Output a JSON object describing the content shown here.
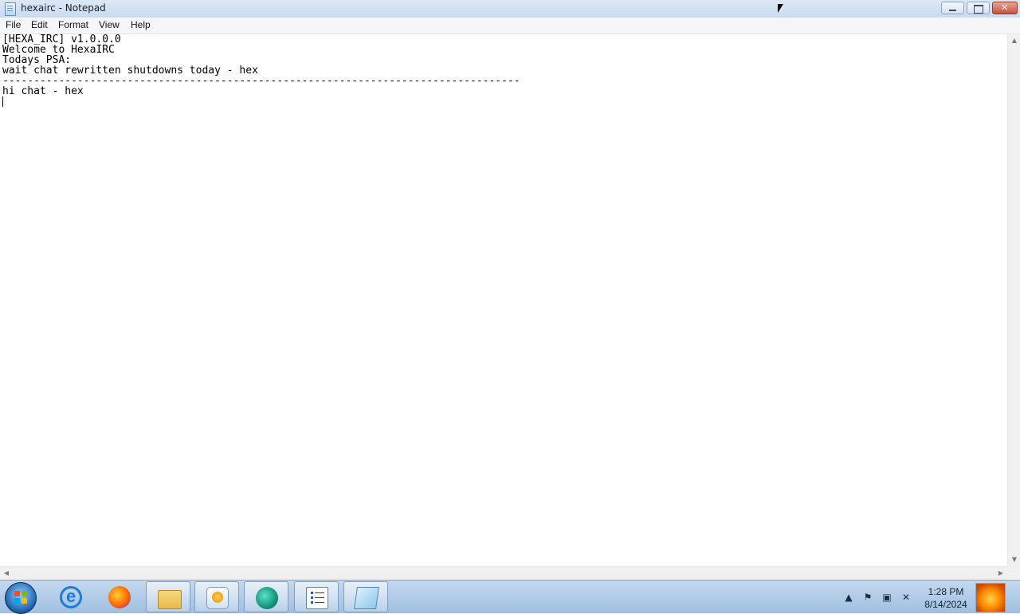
{
  "window": {
    "title": "hexairc - Notepad",
    "icon": "notepad-icon"
  },
  "menu": {
    "items": [
      "File",
      "Edit",
      "Format",
      "View",
      "Help"
    ]
  },
  "document": {
    "lines": [
      "[HEXA_IRC] v1.0.0.0",
      "Welcome to HexaIRC",
      "",
      "Todays PSA:",
      "wait chat rewritten shutdowns today - hex",
      "-----------------------------------------------------------------------------------",
      "hi chat - hex",
      ""
    ]
  },
  "taskbar": {
    "apps": [
      {
        "name": "internet-explorer-icon",
        "active": false
      },
      {
        "name": "firefox-icon",
        "active": false
      },
      {
        "name": "file-explorer-icon",
        "active": true
      },
      {
        "name": "media-player-icon",
        "active": true
      },
      {
        "name": "chat-app-icon",
        "active": true
      },
      {
        "name": "task-list-icon",
        "active": true
      },
      {
        "name": "notepad-icon",
        "active": true
      }
    ],
    "clock": {
      "time": "1:28 PM",
      "date": "8/14/2024"
    }
  }
}
